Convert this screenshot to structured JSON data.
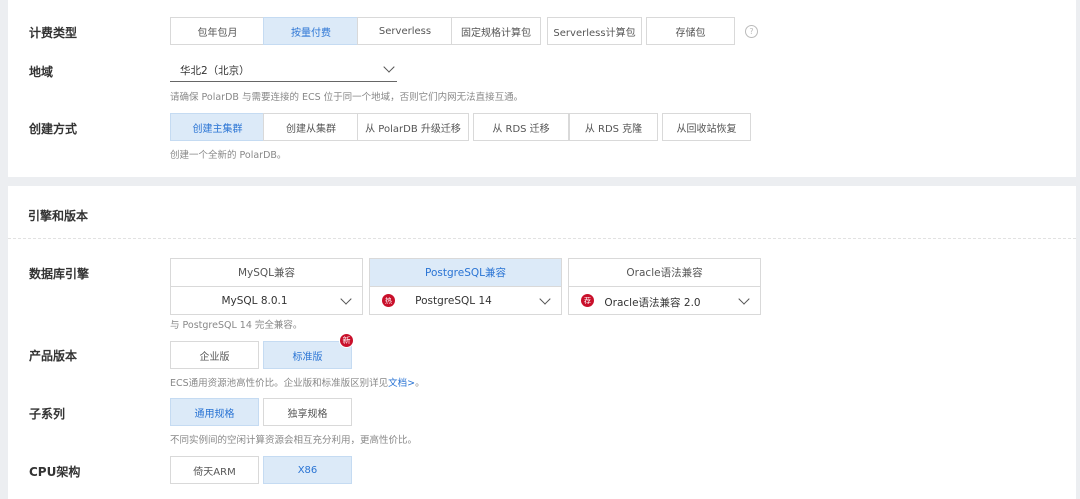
{
  "billing": {
    "label": "计费类型",
    "options": [
      "包年包月",
      "按量付费",
      "Serverless",
      "固定规格计算包",
      "Serverless计算包",
      "存储包"
    ],
    "help_icon": "?"
  },
  "region": {
    "label": "地域",
    "value": "华北2（北京）",
    "hint": "请确保 PolarDB 与需要连接的 ECS 位于同一个地域，否则它们内网无法直接互通。"
  },
  "creation": {
    "label": "创建方式",
    "options": [
      "创建主集群",
      "创建从集群",
      "从 PolarDB 升级迁移",
      "从 RDS 迁移",
      "从 RDS 克隆",
      "从回收站恢复"
    ],
    "hint": "创建一个全新的 PolarDB。"
  },
  "engine_section": {
    "title": "引擎和版本"
  },
  "engine": {
    "label": "数据库引擎",
    "cards": [
      {
        "name": "MySQL兼容",
        "version": "MySQL 8.0.1",
        "tag": ""
      },
      {
        "name": "PostgreSQL兼容",
        "version": "PostgreSQL 14",
        "tag": "热"
      },
      {
        "name": "Oracle语法兼容",
        "version": "Oracle语法兼容 2.0",
        "tag": "荐"
      }
    ],
    "hint": "与 PostgreSQL 14 完全兼容。"
  },
  "edition": {
    "label": "产品版本",
    "options": [
      "企业版",
      "标准版"
    ],
    "new_badge": "新",
    "hint": "ECS通用资源池高性价比。企业版和标准版区别详见",
    "hint_link": "文档>",
    "hint_end": "。"
  },
  "series": {
    "label": "子系列",
    "options": [
      "通用规格",
      "独享规格"
    ],
    "hint": "不同实例间的空闲计算资源会相互充分利用，更高性价比。"
  },
  "cpu": {
    "label": "CPU架构",
    "options": [
      "倚天ARM",
      "X86"
    ]
  }
}
